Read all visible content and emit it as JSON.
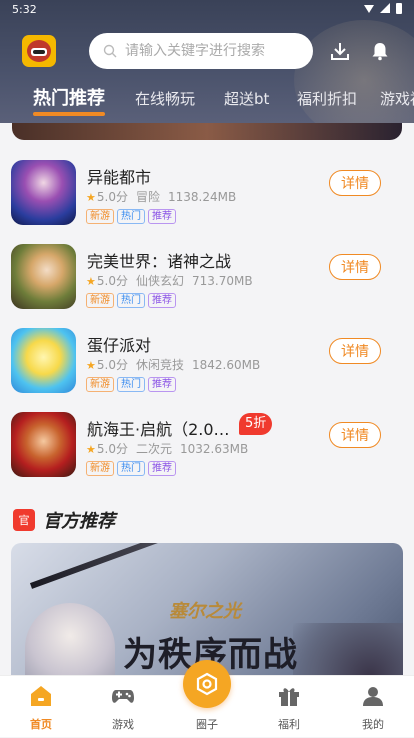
{
  "status_bar": {
    "time": "5:32"
  },
  "search": {
    "placeholder": "请输入关键字进行搜索"
  },
  "tabs": [
    {
      "label": "热门推荐",
      "active": true
    },
    {
      "label": "在线畅玩"
    },
    {
      "label": "超送bt"
    },
    {
      "label": "福利折扣"
    },
    {
      "label": "游戏福利"
    }
  ],
  "games": [
    {
      "name": "异能都市",
      "rating": "5.0分",
      "genre": "冒险",
      "size": "1138.24MB",
      "discount": null,
      "tags": [
        "新游",
        "热门",
        "推荐"
      ],
      "detail_label": "详情"
    },
    {
      "name": "完美世界：诸神之战",
      "rating": "5.0分",
      "genre": "仙侠玄幻",
      "size": "713.70MB",
      "discount": null,
      "tags": [
        "新游",
        "热门",
        "推荐"
      ],
      "detail_label": "详情"
    },
    {
      "name": "蛋仔派对",
      "rating": "5.0分",
      "genre": "休闲竞技",
      "size": "1842.60MB",
      "discount": null,
      "tags": [
        "新游",
        "热门",
        "推荐"
      ],
      "detail_label": "详情"
    },
    {
      "name": "航海王·启航（2.0大…",
      "rating": "5.0分",
      "genre": "二次元",
      "size": "1032.63MB",
      "discount": "5折",
      "tags": [
        "新游",
        "热门",
        "推荐"
      ],
      "detail_label": "详情"
    }
  ],
  "section": {
    "icon_text": "官",
    "title": "官方推荐"
  },
  "promo": {
    "logo": "塞尔之光",
    "slogan": "为秩序而战"
  },
  "bottom_nav": [
    {
      "label": "首页",
      "icon": "home-icon",
      "active": true
    },
    {
      "label": "游戏",
      "icon": "gamepad-icon"
    },
    {
      "label": "圈子",
      "icon": "circle-icon"
    },
    {
      "label": "福利",
      "icon": "gift-icon"
    },
    {
      "label": "我的",
      "icon": "user-icon"
    }
  ],
  "colors": {
    "accent": "#f08a24",
    "discount": "#f03a2e",
    "header": "#434a61"
  }
}
